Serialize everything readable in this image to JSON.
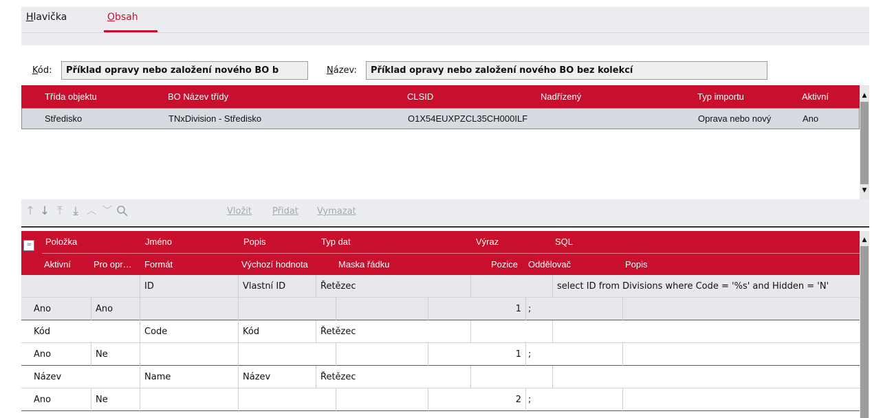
{
  "tabs": [
    {
      "label": "Hlavička",
      "underline_char": "H",
      "rest": "lavička"
    },
    {
      "label": "Obsah",
      "underline_char": "O",
      "rest": "bsah"
    }
  ],
  "header": {
    "code_label_u": "K",
    "code_label_rest": "ód:",
    "code_value": "Příklad opravy nebo založení nového BO b",
    "name_label_u": "N",
    "name_label_rest": "ázev:",
    "name_value": "Příklad opravy nebo založení nového BO bez kolekcí"
  },
  "objects_grid": {
    "columns": [
      "Třída objektu",
      "BO Název třídy",
      "CLSID",
      "Nadřízený",
      "Typ importu",
      "Aktivní"
    ],
    "rows": [
      {
        "class": "Středisko",
        "bo_class_name": "TNxDivision - Středisko",
        "clsid": "O1X54EUXPZCL35CH000ILF",
        "parent": "",
        "import_type": "Oprava nebo nový",
        "active": "Ano"
      }
    ]
  },
  "toolbar": {
    "icons": [
      "move-up-icon",
      "move-down-icon",
      "move-top-icon",
      "move-bottom-icon",
      "chevron-up-icon",
      "chevron-down-icon",
      "search-icon"
    ],
    "insert_label": "Vložit",
    "add_label": "Přidat",
    "delete_label": "Vymazat"
  },
  "items_grid": {
    "header_row1": [
      "Položka",
      "Jméno",
      "Popis",
      "Typ dat",
      "Výraz",
      "SQL"
    ],
    "header_row2": [
      "Aktivní",
      "Pro opr…",
      "Formát",
      "Výchozí hodnota",
      "Maska řádku",
      "Pozice",
      "Oddělovač",
      "Popis"
    ],
    "records": [
      {
        "item": "",
        "name": "ID",
        "description": "Vlastní ID",
        "data_type": "Řetězec",
        "expression": "",
        "sql": "select ID from Divisions where Code = '%s' and Hidden = 'N'",
        "active": "Ano",
        "for_repair": "Ano",
        "format": "",
        "default_value": "",
        "row_mask": "",
        "position": "1",
        "separator": ";",
        "description2": ""
      },
      {
        "item": "Kód",
        "name": "Code",
        "description": "Kód",
        "data_type": "Řetězec",
        "expression": "",
        "sql": "",
        "active": "Ano",
        "for_repair": "Ne",
        "format": "",
        "default_value": "",
        "row_mask": "",
        "position": "1",
        "separator": ";",
        "description2": ""
      },
      {
        "item": "Název",
        "name": "Name",
        "description": "Název",
        "data_type": "Řetězec",
        "expression": "",
        "sql": "",
        "active": "Ano",
        "for_repair": "Ne",
        "format": "",
        "default_value": "",
        "row_mask": "",
        "position": "2",
        "separator": ";",
        "description2": ""
      }
    ]
  },
  "colors": {
    "accent": "#c8102e",
    "selected_row": "#d7dae1",
    "panel": "#ecedf0"
  }
}
